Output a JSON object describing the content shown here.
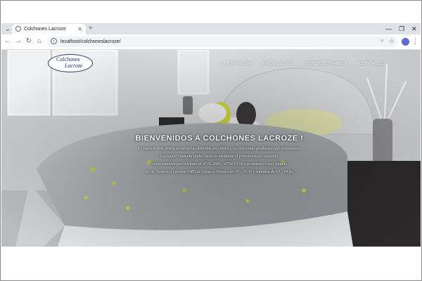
{
  "tab": {
    "title": "Colchones Lacroze",
    "close_glyph": "✕",
    "favicon": "globe-icon"
  },
  "tabstrip": {
    "menu_glyph": "⌄",
    "newtab_glyph": "+",
    "minimize_glyph": "—",
    "restore_glyph": "❐",
    "close_glyph": "✕"
  },
  "toolbar": {
    "back_glyph": "←",
    "forward_glyph": "→",
    "reload_glyph": "↻",
    "home_glyph": "⌂",
    "url": "localhost/colchoneslacroze/",
    "info_glyph": "i",
    "zoom_glyph": "⌕",
    "star_glyph": "☆",
    "menu_glyph": "⋮"
  },
  "site": {
    "logo": {
      "line1": "Colchones",
      "line2": "Lacroze"
    },
    "nav": [
      "LA EMPRESA",
      "PRODUCTOS",
      "DONDE ESTAMOS",
      "CONTACTO"
    ],
    "hero": {
      "title": "BIENVENIDOS A COLCHONES LACROZE !",
      "lines": [
        "En nuestra web podra recorrer las distintas secciones y los diferentes productos que trabajamos.",
        "Cualquier consulta podra hacerla mediante el formulario de contacto,",
        "como tambien por telefono al 4771-2685 / 4778-7158 o en nuestro local situado",
        "en Av. Federico Lacroze 2483 de Lunes a Viernes de 10 - 19.30 y sabados de 10 - 14 hs."
      ]
    }
  },
  "colors": {
    "accent": "#4285f4",
    "tab_strip": "#dee1e6",
    "logo_blue": "#1f3474"
  }
}
